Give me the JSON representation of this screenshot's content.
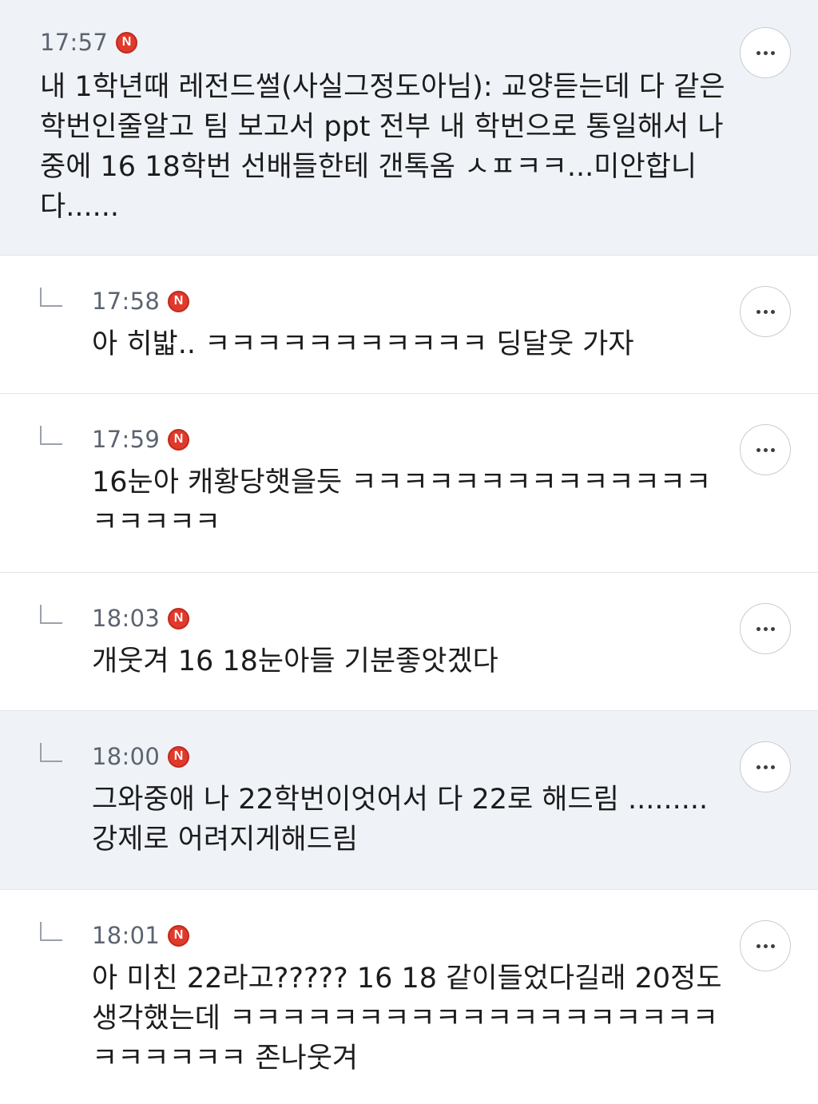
{
  "colors": {
    "highlight_background": "#eff3f8",
    "badge": "#e03a2c",
    "divider": "#e2e5ea"
  },
  "comments": [
    {
      "time": "17:57",
      "badge": "N",
      "text": "내 1학년때 레전드썰(사실그정도아님): 교양듣는데 다 같은 학번인줄알고 팀 보고서 ppt 전부 내 학번으로 통일해서 나중에 16 18학번 선배들한테 갠톡옴 ㅅㅍㅋㅋ...미안합니다......",
      "highlighted": true,
      "is_reply": false,
      "more_icon": "more-horizontal-icon"
    },
    {
      "time": "17:58",
      "badge": "N",
      "text": "아 히밟.. ㅋㅋㅋㅋㅋㅋㅋㅋㅋㅋㅋ 딩달웃 가자",
      "highlighted": false,
      "is_reply": true,
      "reply_icon": "reply-arrow-icon",
      "more_icon": "more-horizontal-icon"
    },
    {
      "time": "17:59",
      "badge": "N",
      "text": "16눈아 캐황당햇을듯 ㅋㅋㅋㅋㅋㅋㅋㅋㅋㅋㅋㅋㅋㅋㅋㅋㅋㅋㅋ",
      "highlighted": false,
      "is_reply": true,
      "reply_icon": "reply-arrow-icon",
      "more_icon": "more-horizontal-icon"
    },
    {
      "time": "18:03",
      "badge": "N",
      "text": "개웃겨 16 18눈아들 기분좋앗겠다",
      "highlighted": false,
      "is_reply": true,
      "reply_icon": "reply-arrow-icon",
      "more_icon": "more-horizontal-icon"
    },
    {
      "time": "18:00",
      "badge": "N",
      "text": "그와중애 나 22학번이엇어서 다 22로 해드림 ......... 강제로 어려지게해드림",
      "highlighted": true,
      "is_reply": true,
      "reply_icon": "reply-arrow-icon",
      "more_icon": "more-horizontal-icon"
    },
    {
      "time": "18:01",
      "badge": "N",
      "text": "아 미친 22라고????? 16 18 같이들었다길래 20정도 생각했는데 ㅋㅋㅋㅋㅋㅋㅋㅋㅋㅋㅋㅋㅋㅋㅋㅋㅋㅋㅋㅋㅋㅋㅋㅋㅋ 존나웃겨",
      "highlighted": false,
      "is_reply": true,
      "reply_icon": "reply-arrow-icon",
      "more_icon": "more-horizontal-icon"
    }
  ]
}
